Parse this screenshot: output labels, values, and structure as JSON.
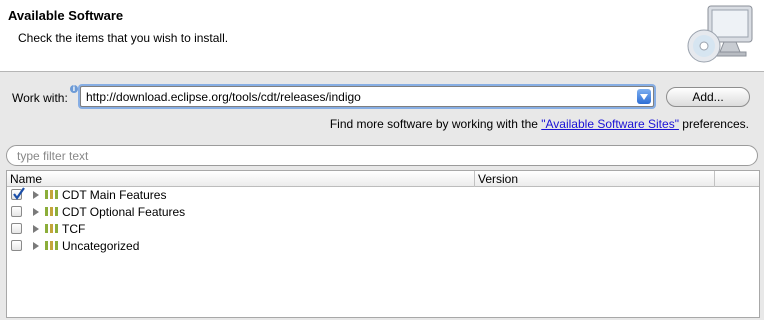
{
  "header": {
    "title": "Available Software",
    "description": "Check the items that you wish to install."
  },
  "work_with": {
    "label": "Work with:",
    "value": "http://download.eclipse.org/tools/cdt/releases/indigo",
    "add_label": "Add..."
  },
  "find_more": {
    "prefix": "Find more software by working with the ",
    "link": "\"Available Software Sites\"",
    "suffix": " preferences."
  },
  "filter": {
    "placeholder": "type filter text"
  },
  "table": {
    "columns": [
      "Name",
      "Version"
    ],
    "rows": [
      {
        "label": "CDT Main Features",
        "checked": true
      },
      {
        "label": "CDT Optional Features",
        "checked": false
      },
      {
        "label": "TCF",
        "checked": false
      },
      {
        "label": "Uncategorized",
        "checked": false
      }
    ]
  },
  "icons": {
    "header": "computer-cd-install-icon",
    "info": "info-icon",
    "expand": "triangle-right-icon",
    "category": "package-category-icon",
    "dropdown": "chevron-down-icon"
  },
  "colors": {
    "link": "#1a12d6",
    "focus": "#87aee4"
  }
}
